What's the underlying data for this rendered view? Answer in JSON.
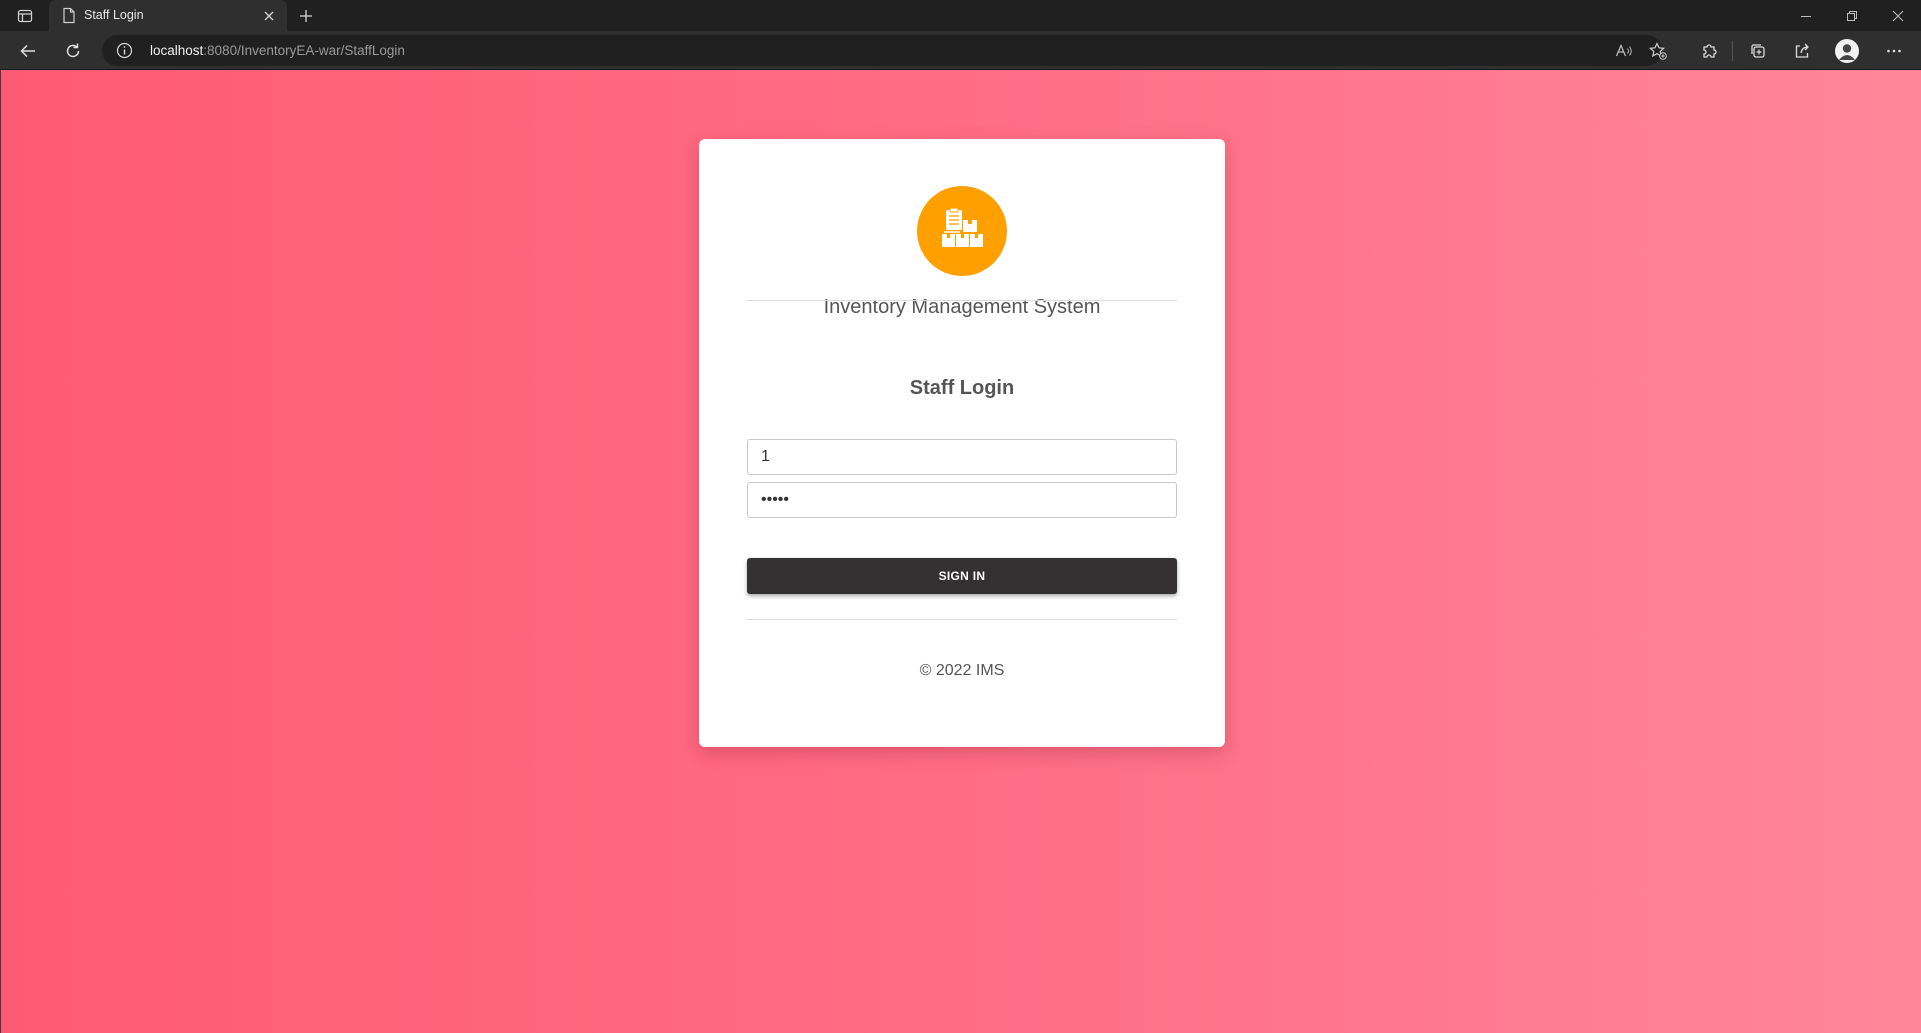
{
  "browser": {
    "tab": {
      "title": "Staff Login"
    },
    "address": {
      "host": "localhost",
      "rest": ":8080/InventoryEA-war/StaffLogin"
    }
  },
  "page": {
    "logo_icon": "inventory-boxes-icon",
    "app_title": "Inventory Management System",
    "login_title": "Staff Login",
    "username": {
      "value": "1"
    },
    "password": {
      "value": "•••••"
    },
    "signin_label": "SIGN IN",
    "footer": "© 2022 IMS"
  },
  "colors": {
    "background_start": "#ff5a75",
    "background_end": "#ff8699",
    "logo": "#ffa000",
    "button": "#333131",
    "card": "#ffffff"
  }
}
